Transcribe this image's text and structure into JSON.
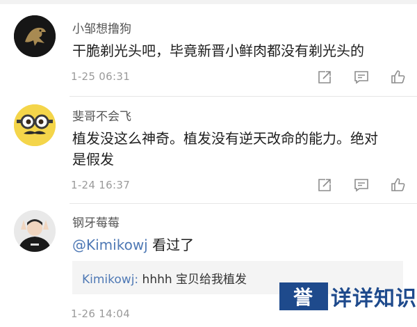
{
  "comments": [
    {
      "username": "小邹想撸狗",
      "text": "干脆剃光头吧，毕竟新晋小鲜肉都没有剃光头的",
      "timestamp": "1-25 06:31",
      "avatar_icon": "dark-dragon-emblem-avatar"
    },
    {
      "username": "斐哥不会飞",
      "text_line1": "植发没这么神奇。植发没有逆天改命的能力。绝对",
      "text_line2": "是假发",
      "timestamp": "1-24 16:37",
      "avatar_icon": "minion-mustache-avatar"
    },
    {
      "username": "钢牙莓莓",
      "mention": "@Kimikowj",
      "text": " 看过了",
      "reply_user": "Kimikowj:",
      "reply_text": " hhhh 宝贝给我植发",
      "timestamp": "1-26 14:04",
      "avatar_icon": "person-hoodie-avatar"
    }
  ],
  "action_icons": [
    "share-icon",
    "comment-icon",
    "like-icon"
  ],
  "watermark": {
    "box_text": "誉",
    "rest_text": "详详知识"
  },
  "colors": {
    "mention": "#4f79b5",
    "watermark": "#1e4a8c",
    "timestamp": "#9a9a9a"
  }
}
